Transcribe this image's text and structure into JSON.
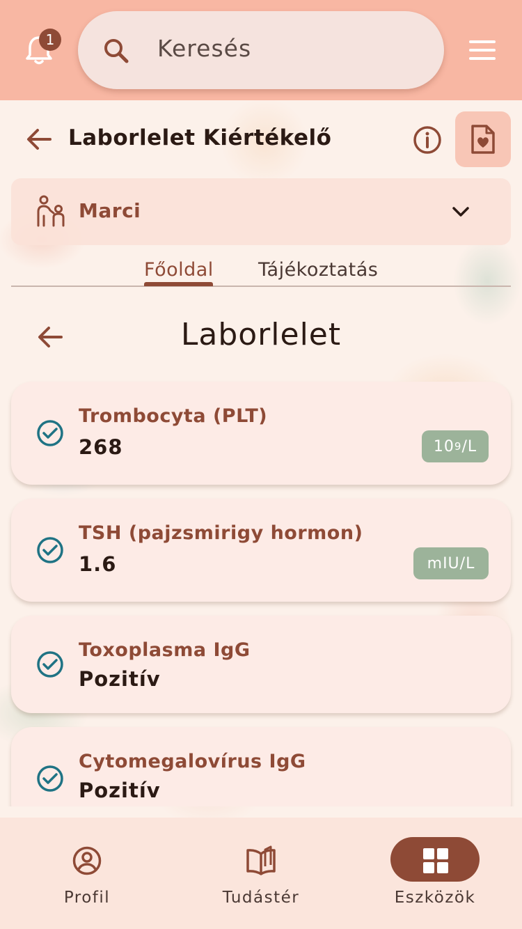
{
  "topbar": {
    "notification_count": "1",
    "search_placeholder": "Keresés"
  },
  "header": {
    "title": "Laborlelet Kiértékelő"
  },
  "profile_select": {
    "name": "Marci"
  },
  "tabs": [
    {
      "label": "Főoldal",
      "active": true
    },
    {
      "label": "Tájékoztatás",
      "active": false
    }
  ],
  "section": {
    "title": "Laborlelet"
  },
  "results": [
    {
      "name": "Trombocyta (PLT)",
      "value": "268",
      "unit_base": "10",
      "unit_exp": "9",
      "unit_rest": "/L"
    },
    {
      "name": "TSH (pajzsmirigy hormon)",
      "value": "1.6",
      "unit": "mIU/L"
    },
    {
      "name": "Toxoplasma IgG",
      "value": "Pozitív"
    },
    {
      "name": "Cytomegalovírus IgG",
      "value": "Pozitív"
    }
  ],
  "bottom_nav": [
    {
      "label": "Profil",
      "icon": "profile-icon",
      "active": false
    },
    {
      "label": "Tudástér",
      "icon": "book-icon",
      "active": false
    },
    {
      "label": "Eszközök",
      "icon": "grid-icon",
      "active": true
    }
  ],
  "colors": {
    "topbar": "#f8b7a3",
    "accent": "#8e4a36",
    "unit_badge": "#9cb39a",
    "check": "#1f7384",
    "card": "#fdebe6"
  }
}
